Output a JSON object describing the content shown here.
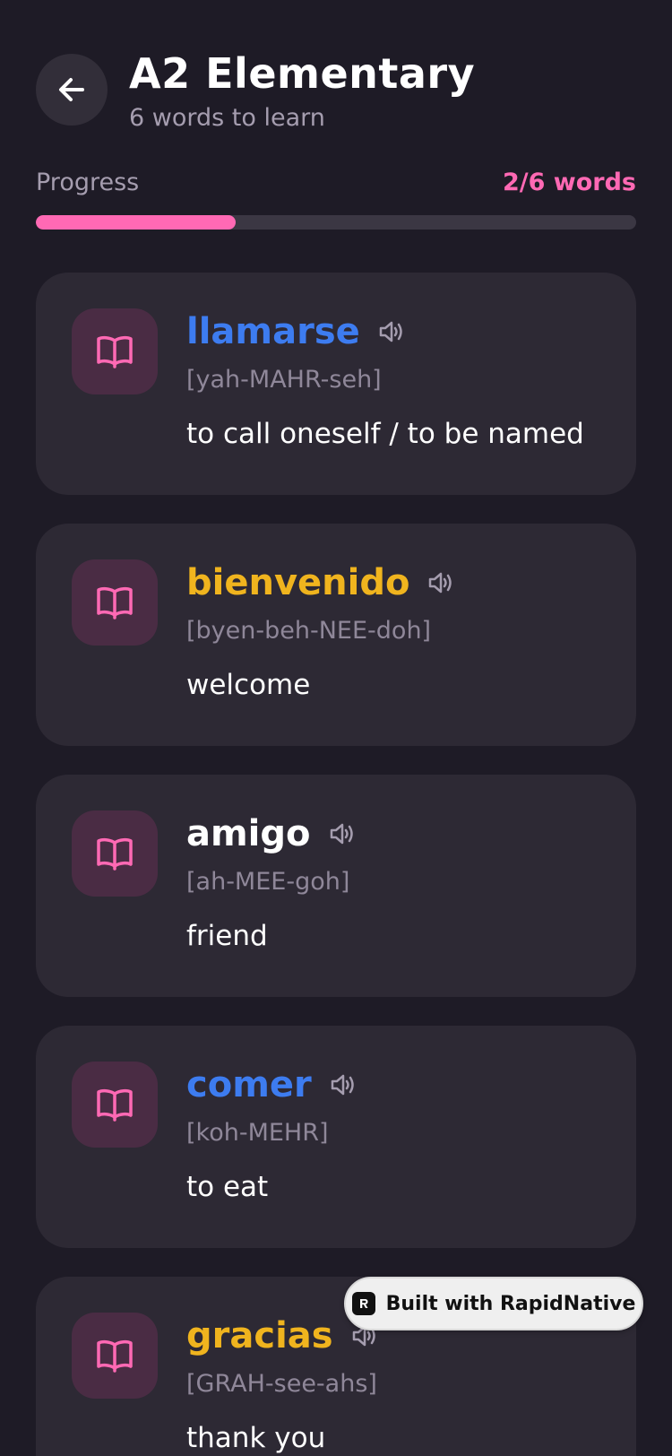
{
  "header": {
    "title": "A2 Elementary",
    "subtitle": "6 words to learn",
    "back_icon": "arrow-left-icon"
  },
  "progress": {
    "label": "Progress",
    "count_text": "2/6 words",
    "fraction": 0.333,
    "color": "#ff69b4"
  },
  "words": [
    {
      "word": "llamarse",
      "pronunciation": "[yah-MAHR-seh]",
      "meaning": "to call oneself / to be named",
      "color": "#3d7cf0"
    },
    {
      "word": "bienvenido",
      "pronunciation": "[byen-beh-NEE-doh]",
      "meaning": "welcome",
      "color": "#f0b41e"
    },
    {
      "word": "amigo",
      "pronunciation": "[ah-MEE-goh]",
      "meaning": "friend",
      "color": "#ffffff"
    },
    {
      "word": "comer",
      "pronunciation": "[koh-MEHR]",
      "meaning": "to eat",
      "color": "#3d7cf0"
    },
    {
      "word": "gracias",
      "pronunciation": "[GRAH-see-ahs]",
      "meaning": "thank you",
      "color": "#f0b41e"
    }
  ],
  "icons": {
    "card": "book-open-icon",
    "audio": "speaker-icon"
  },
  "badge": {
    "text": "Built with RapidNative"
  }
}
